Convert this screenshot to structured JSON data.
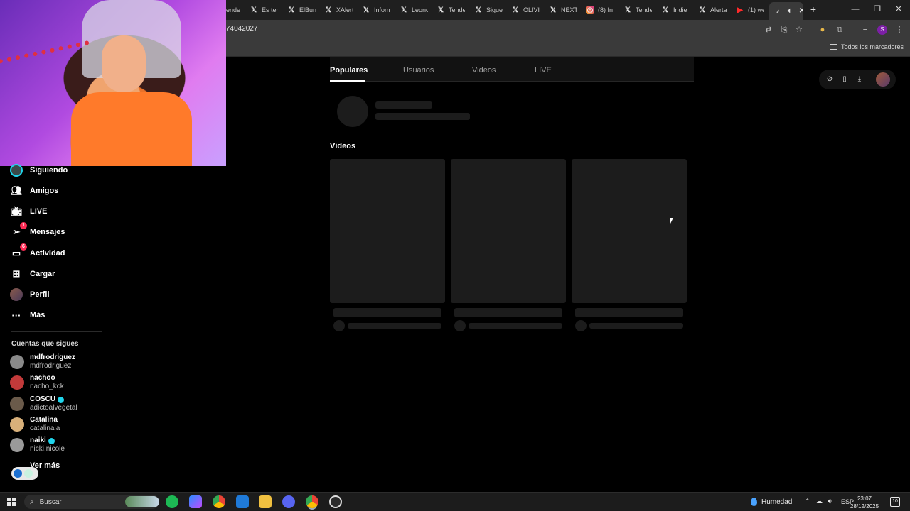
{
  "browser": {
    "tabs": [
      {
        "label": "ende",
        "icon": "x-icon"
      },
      {
        "label": "Es ter",
        "icon": "x-icon"
      },
      {
        "label": "ElBun",
        "icon": "x-icon"
      },
      {
        "label": "XAlert",
        "icon": "x-icon"
      },
      {
        "label": "Infom",
        "icon": "x-icon"
      },
      {
        "label": "Leonc",
        "icon": "x-icon"
      },
      {
        "label": "Tende",
        "icon": "x-icon"
      },
      {
        "label": "Sigue",
        "icon": "x-icon"
      },
      {
        "label": "OLIVI",
        "icon": "x-icon"
      },
      {
        "label": "NEXT",
        "icon": "x-icon"
      },
      {
        "label": "(8) In",
        "icon": "instagram-icon"
      },
      {
        "label": "Tende",
        "icon": "x-icon"
      },
      {
        "label": "Indie",
        "icon": "x-icon"
      },
      {
        "label": "Alerta",
        "icon": "x-icon"
      },
      {
        "label": "(1) we",
        "icon": "youtube-icon"
      }
    ],
    "url_fragment": "74042027",
    "bookmarks_all": "Todos los marcadores",
    "profile_initial": "S"
  },
  "sidebar": {
    "nav": [
      {
        "label": "Siguiendo",
        "icon": "following-avatar-icon",
        "badge": ""
      },
      {
        "label": "Amigos",
        "icon": "friends-icon",
        "badge": ""
      },
      {
        "label": "LIVE",
        "icon": "live-icon",
        "badge": ""
      },
      {
        "label": "Mensajes",
        "icon": "messages-icon",
        "badge": "1"
      },
      {
        "label": "Actividad",
        "icon": "activity-icon",
        "badge": "6"
      },
      {
        "label": "Cargar",
        "icon": "upload-icon",
        "badge": ""
      },
      {
        "label": "Perfil",
        "icon": "profile-avatar-icon",
        "badge": ""
      },
      {
        "label": "Más",
        "icon": "more-icon",
        "badge": ""
      }
    ],
    "following_title": "Cuentas que sigues",
    "accounts": [
      {
        "name": "mdfrodriguez",
        "handle": "mdfrodriguez",
        "verified": false
      },
      {
        "name": "nachoo",
        "handle": "nacho_kck",
        "verified": false
      },
      {
        "name": "COSCU",
        "handle": "adictoalvegetal",
        "verified": true
      },
      {
        "name": "Catalina",
        "handle": "catalinaia",
        "verified": false
      },
      {
        "name": "naiki",
        "handle": "nicki.nicole",
        "verified": true
      }
    ],
    "see_more": "Ver más"
  },
  "main": {
    "tabs": [
      "Populares",
      "Usuarios",
      "Videos",
      "LIVE"
    ],
    "videos_title": "Vídeos"
  },
  "taskbar": {
    "search_placeholder": "Buscar",
    "weather": "Humedad",
    "lang": "ESP",
    "time": "23:07",
    "date": "28/12/2025",
    "notif_count": "10"
  },
  "colors": {
    "background": "#000000",
    "badge": "#fe2c55",
    "verified": "#20d5ec"
  }
}
